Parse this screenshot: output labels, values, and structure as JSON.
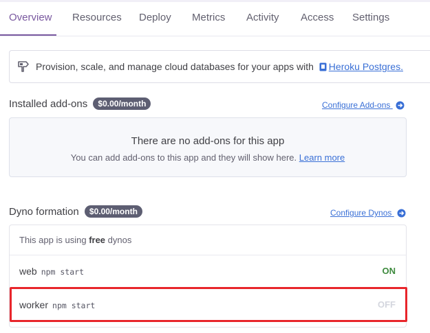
{
  "tabs": [
    "Overview",
    "Resources",
    "Deploy",
    "Metrics",
    "Activity",
    "Access",
    "Settings"
  ],
  "banner": {
    "text": "Provision, scale, and manage cloud databases for your apps with",
    "link": "Heroku Postgres."
  },
  "addons": {
    "title": "Installed add-ons",
    "badge": "$0.00/month",
    "configure": "Configure Add-ons",
    "empty_title": "There are no add-ons for this app",
    "empty_sub": "You can add add-ons to this app and they will show here.",
    "learn_more": "Learn more"
  },
  "dynos": {
    "title": "Dyno formation",
    "badge": "$0.00/month",
    "configure": "Configure Dynos",
    "free_prefix": "This app is using",
    "free_word": "free",
    "free_suffix": "dynos",
    "rows": [
      {
        "name": "web",
        "command": "npm start",
        "status": "ON"
      },
      {
        "name": "worker",
        "command": "npm start",
        "status": "OFF"
      }
    ]
  },
  "colors": {
    "accent": "#79589f",
    "link": "#396fd6",
    "badge_bg": "#5d5e72",
    "status_on": "#3d8a3d",
    "status_off": "#d4d6de",
    "highlight": "#e8252b"
  }
}
